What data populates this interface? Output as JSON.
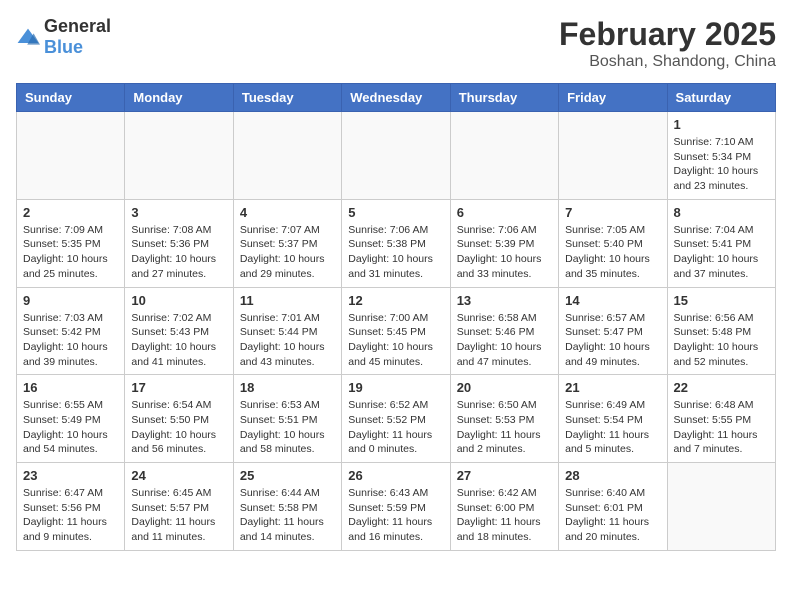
{
  "logo": {
    "general": "General",
    "blue": "Blue"
  },
  "header": {
    "month": "February 2025",
    "location": "Boshan, Shandong, China"
  },
  "weekdays": [
    "Sunday",
    "Monday",
    "Tuesday",
    "Wednesday",
    "Thursday",
    "Friday",
    "Saturday"
  ],
  "weeks": [
    [
      {
        "day": "",
        "info": ""
      },
      {
        "day": "",
        "info": ""
      },
      {
        "day": "",
        "info": ""
      },
      {
        "day": "",
        "info": ""
      },
      {
        "day": "",
        "info": ""
      },
      {
        "day": "",
        "info": ""
      },
      {
        "day": "1",
        "info": "Sunrise: 7:10 AM\nSunset: 5:34 PM\nDaylight: 10 hours and 23 minutes."
      }
    ],
    [
      {
        "day": "2",
        "info": "Sunrise: 7:09 AM\nSunset: 5:35 PM\nDaylight: 10 hours and 25 minutes."
      },
      {
        "day": "3",
        "info": "Sunrise: 7:08 AM\nSunset: 5:36 PM\nDaylight: 10 hours and 27 minutes."
      },
      {
        "day": "4",
        "info": "Sunrise: 7:07 AM\nSunset: 5:37 PM\nDaylight: 10 hours and 29 minutes."
      },
      {
        "day": "5",
        "info": "Sunrise: 7:06 AM\nSunset: 5:38 PM\nDaylight: 10 hours and 31 minutes."
      },
      {
        "day": "6",
        "info": "Sunrise: 7:06 AM\nSunset: 5:39 PM\nDaylight: 10 hours and 33 minutes."
      },
      {
        "day": "7",
        "info": "Sunrise: 7:05 AM\nSunset: 5:40 PM\nDaylight: 10 hours and 35 minutes."
      },
      {
        "day": "8",
        "info": "Sunrise: 7:04 AM\nSunset: 5:41 PM\nDaylight: 10 hours and 37 minutes."
      }
    ],
    [
      {
        "day": "9",
        "info": "Sunrise: 7:03 AM\nSunset: 5:42 PM\nDaylight: 10 hours and 39 minutes."
      },
      {
        "day": "10",
        "info": "Sunrise: 7:02 AM\nSunset: 5:43 PM\nDaylight: 10 hours and 41 minutes."
      },
      {
        "day": "11",
        "info": "Sunrise: 7:01 AM\nSunset: 5:44 PM\nDaylight: 10 hours and 43 minutes."
      },
      {
        "day": "12",
        "info": "Sunrise: 7:00 AM\nSunset: 5:45 PM\nDaylight: 10 hours and 45 minutes."
      },
      {
        "day": "13",
        "info": "Sunrise: 6:58 AM\nSunset: 5:46 PM\nDaylight: 10 hours and 47 minutes."
      },
      {
        "day": "14",
        "info": "Sunrise: 6:57 AM\nSunset: 5:47 PM\nDaylight: 10 hours and 49 minutes."
      },
      {
        "day": "15",
        "info": "Sunrise: 6:56 AM\nSunset: 5:48 PM\nDaylight: 10 hours and 52 minutes."
      }
    ],
    [
      {
        "day": "16",
        "info": "Sunrise: 6:55 AM\nSunset: 5:49 PM\nDaylight: 10 hours and 54 minutes."
      },
      {
        "day": "17",
        "info": "Sunrise: 6:54 AM\nSunset: 5:50 PM\nDaylight: 10 hours and 56 minutes."
      },
      {
        "day": "18",
        "info": "Sunrise: 6:53 AM\nSunset: 5:51 PM\nDaylight: 10 hours and 58 minutes."
      },
      {
        "day": "19",
        "info": "Sunrise: 6:52 AM\nSunset: 5:52 PM\nDaylight: 11 hours and 0 minutes."
      },
      {
        "day": "20",
        "info": "Sunrise: 6:50 AM\nSunset: 5:53 PM\nDaylight: 11 hours and 2 minutes."
      },
      {
        "day": "21",
        "info": "Sunrise: 6:49 AM\nSunset: 5:54 PM\nDaylight: 11 hours and 5 minutes."
      },
      {
        "day": "22",
        "info": "Sunrise: 6:48 AM\nSunset: 5:55 PM\nDaylight: 11 hours and 7 minutes."
      }
    ],
    [
      {
        "day": "23",
        "info": "Sunrise: 6:47 AM\nSunset: 5:56 PM\nDaylight: 11 hours and 9 minutes."
      },
      {
        "day": "24",
        "info": "Sunrise: 6:45 AM\nSunset: 5:57 PM\nDaylight: 11 hours and 11 minutes."
      },
      {
        "day": "25",
        "info": "Sunrise: 6:44 AM\nSunset: 5:58 PM\nDaylight: 11 hours and 14 minutes."
      },
      {
        "day": "26",
        "info": "Sunrise: 6:43 AM\nSunset: 5:59 PM\nDaylight: 11 hours and 16 minutes."
      },
      {
        "day": "27",
        "info": "Sunrise: 6:42 AM\nSunset: 6:00 PM\nDaylight: 11 hours and 18 minutes."
      },
      {
        "day": "28",
        "info": "Sunrise: 6:40 AM\nSunset: 6:01 PM\nDaylight: 11 hours and 20 minutes."
      },
      {
        "day": "",
        "info": ""
      }
    ]
  ]
}
